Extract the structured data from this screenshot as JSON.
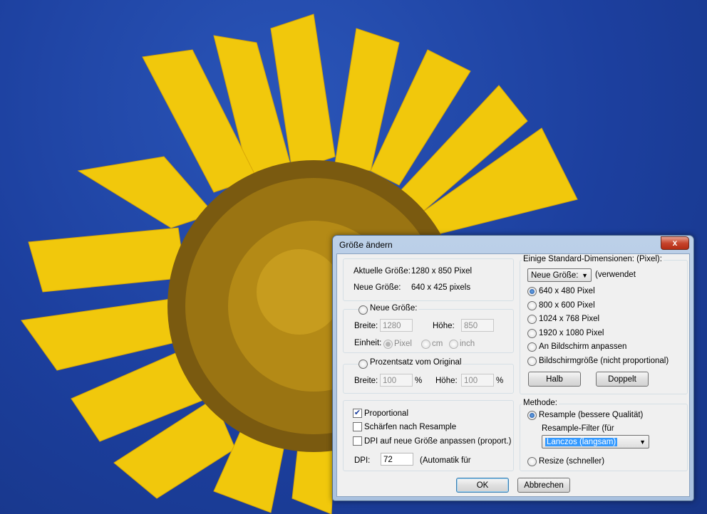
{
  "window": {
    "title": "Größe ändern",
    "close": "x"
  },
  "current": {
    "label": "Aktuelle Größe:",
    "value": "1280  x  850  Pixel"
  },
  "new": {
    "label": "Neue Größe:",
    "value": "640  x  425  pixels"
  },
  "new_size_group": {
    "radio": "Neue Größe:",
    "width_label": "Breite:",
    "width_value": "1280",
    "height_label": "Höhe:",
    "height_value": "850",
    "unit_label": "Einheit:",
    "units": [
      "Pixel",
      "cm",
      "inch"
    ]
  },
  "percent_group": {
    "radio": "Prozentsatz vom Original",
    "width_label": "Breite:",
    "width_value": "100",
    "height_label": "Höhe:",
    "height_value": "100",
    "pct": "%"
  },
  "options": {
    "proportional": "Proportional",
    "sharpen": "Schärfen nach Resample",
    "dpi_adjust": "DPI auf neue Größe anpassen (proport.)",
    "dpi_label": "DPI:",
    "dpi_value": "72",
    "dpi_note": "(Automatik für"
  },
  "standard": {
    "title": "Einige Standard-Dimensionen: (Pixel):",
    "dropdown": "Neue Größe:",
    "used": "(verwendet",
    "sizes": [
      "640 x 480 Pixel",
      "800 x 600 Pixel",
      "1024 x 768 Pixel",
      "1920 x 1080 Pixel",
      "An Bildschirm anpassen",
      "Bildschirmgröße (nicht proportional)"
    ],
    "half": "Halb",
    "double": "Doppelt"
  },
  "method": {
    "title": "Methode:",
    "resample": "Resample (bessere Qualität)",
    "filter_label": "Resample-Filter (für",
    "filter_value": "Lanczos (langsam)",
    "resize": "Resize (schneller)"
  },
  "buttons": {
    "ok": "OK",
    "cancel": "Abbrechen"
  }
}
